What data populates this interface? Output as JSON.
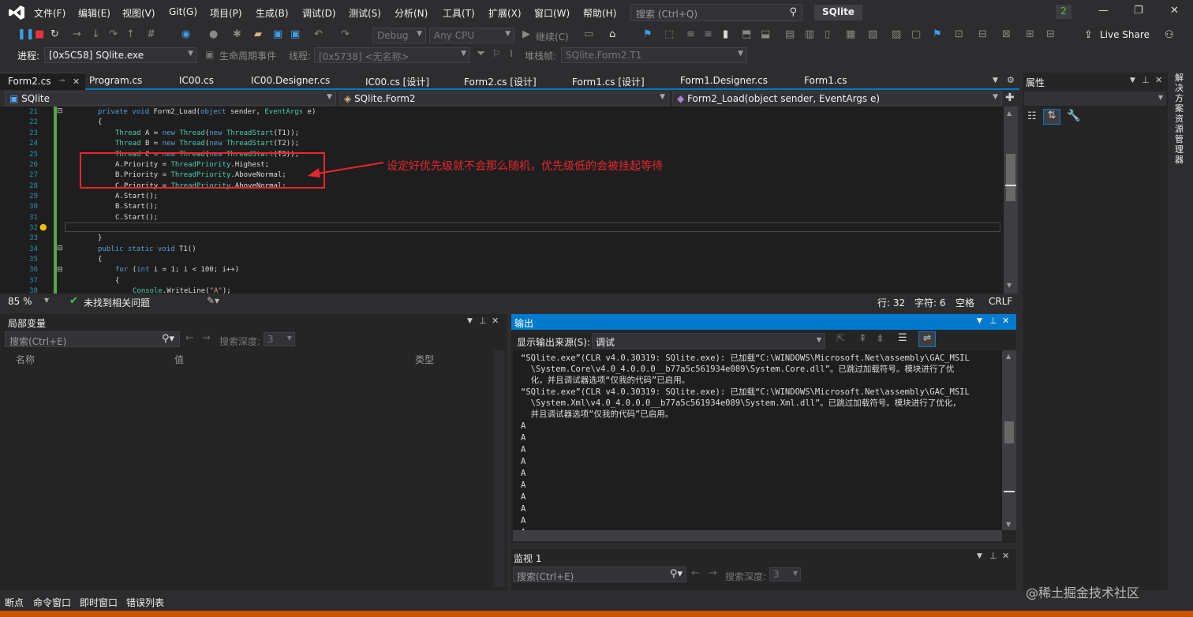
{
  "menu": [
    "文件(F)",
    "编辑(E)",
    "视图(V)",
    "Git(G)",
    "项目(P)",
    "生成(B)",
    "调试(D)",
    "测试(S)",
    "分析(N)",
    "工具(T)",
    "扩展(X)",
    "窗口(W)",
    "帮助(H)"
  ],
  "search": {
    "placeholder": "搜索 (Ctrl+Q)"
  },
  "solution_title": "SQlite",
  "notification_count": "2",
  "toolbar": {
    "config": "Debug",
    "platform": "Any CPU",
    "continue": "继续(C)",
    "live_share": "Live Share"
  },
  "procbar": {
    "label": "进程:",
    "process": "[0x5C58] SQlite.exe",
    "lifecycle": "生命周期事件",
    "thread_label": "线程:",
    "thread": "[0x5738] <无名称>",
    "stack_label": "堆栈帧:",
    "stack": "SQlite.Form2.T1"
  },
  "tabs": [
    "Form2.cs",
    "Program.cs",
    "IC00.cs",
    "IC00.Designer.cs",
    "IC00.cs [设计]",
    "Form2.cs [设计]",
    "Form1.cs [设计]",
    "Form1.Designer.cs",
    "Form1.cs"
  ],
  "nav": {
    "project": "SQlite",
    "class": "SQlite.Form2",
    "method": "Form2_Load(object sender, EventArgs e)"
  },
  "code": {
    "line_numbers": [
      "21",
      "22",
      "23",
      "24",
      "25",
      "26",
      "27",
      "28",
      "29",
      "30",
      "31",
      "32",
      "33",
      "34",
      "35",
      "36",
      "37",
      "38"
    ],
    "l21a": "private void ",
    "l21b": "Form2_Load(",
    "l21c": "object ",
    "l21d": "sender, ",
    "l21e": "EventArgs ",
    "l21f": "e)",
    "l22": "{",
    "l23a": "Thread ",
    "l23b": "A = ",
    "l23c": "new ",
    "l23d": "Thread",
    "l23e": "(",
    "l23f": "new ",
    "l23g": "ThreadStart",
    "l23h": "(T1));",
    "l24a": "Thread ",
    "l24b": "B = ",
    "l24c": "new ",
    "l24d": "Thread",
    "l24e": "(",
    "l24f": "new ",
    "l24g": "ThreadStart",
    "l24h": "(T2));",
    "l25a": "Thread ",
    "l25b": "C = ",
    "l25c": "new ",
    "l25d": "Thread",
    "l25e": "(",
    "l25f": "new ",
    "l25g": "ThreadStart",
    "l25h": "(T3));",
    "l26a": "A.Priority = ",
    "l26b": "ThreadPriority",
    "l26c": ".Highest;",
    "l27a": "B.Priority = ",
    "l27b": "ThreadPriority",
    "l27c": ".AboveNormal;",
    "l28a": "C.Priority = ",
    "l28b": "ThreadPriority",
    "l28c": ".AboveNormal;",
    "l29": "A.Start();",
    "l30": "B.Start();",
    "l31": "C.Start();",
    "l33": "}",
    "l34a": "public static void ",
    "l34b": "T1()",
    "l35": "{",
    "l36a": "for ",
    "l36b": "(",
    "l36c": "int ",
    "l36d": "i = 1; i < 100; i++)",
    "l37": "{",
    "l38a": "Console",
    "l38b": ".WriteLine(",
    "l38c": "\"A\"",
    "l38d": ");"
  },
  "annotation": "设定好优先级就不会那么随机，优先级低的会被挂起等待",
  "editor_status": {
    "zoom": "85 %",
    "issues": "未找到相关问题",
    "line": "行: 32",
    "col": "字符: 6",
    "space": "空格",
    "eol": "CRLF"
  },
  "properties": {
    "title": "属性"
  },
  "right_sidebar": "解决方案资源管理器",
  "locals": {
    "title": "局部变量",
    "search_placeholder": "搜索(Ctrl+E)",
    "depth_label": "搜索深度:",
    "depth": "3",
    "col_name": "名称",
    "col_value": "值",
    "col_type": "类型"
  },
  "output": {
    "title": "输出",
    "source_label": "显示输出来源(S):",
    "source": "调试",
    "lines": [
      "“SQlite.exe”(CLR v4.0.30319: SQlite.exe): 已加载“C:\\WINDOWS\\Microsoft.Net\\assembly\\GAC_MSIL",
      "  \\System.Core\\v4.0_4.0.0.0__b77a5c561934e089\\System.Core.dll”。已跳过加载符号。模块进行了优",
      "  化，并且调试器选项“仅我的代码”已启用。",
      "“SQlite.exe”(CLR v4.0.30319: SQlite.exe): 已加载“C:\\WINDOWS\\Microsoft.Net\\assembly\\GAC_MSIL",
      "  \\System.Xml\\v4.0_4.0.0.0__b77a5c561934e089\\System.Xml.dll”。已跳过加载符号。模块进行了优化，",
      "  并且调试器选项“仅我的代码”已启用。",
      "A",
      "A",
      "A",
      "A",
      "A",
      "A",
      "A",
      "A",
      "A",
      "A"
    ]
  },
  "watch": {
    "title": "监视 1",
    "search_placeholder": "搜索(Ctrl+E)",
    "depth_label": "搜索深度:",
    "depth": "3"
  },
  "bottom_tabs": [
    "断点",
    "命令窗口",
    "即时窗口",
    "错误列表"
  ],
  "watermark": "@稀土掘金技术社区"
}
